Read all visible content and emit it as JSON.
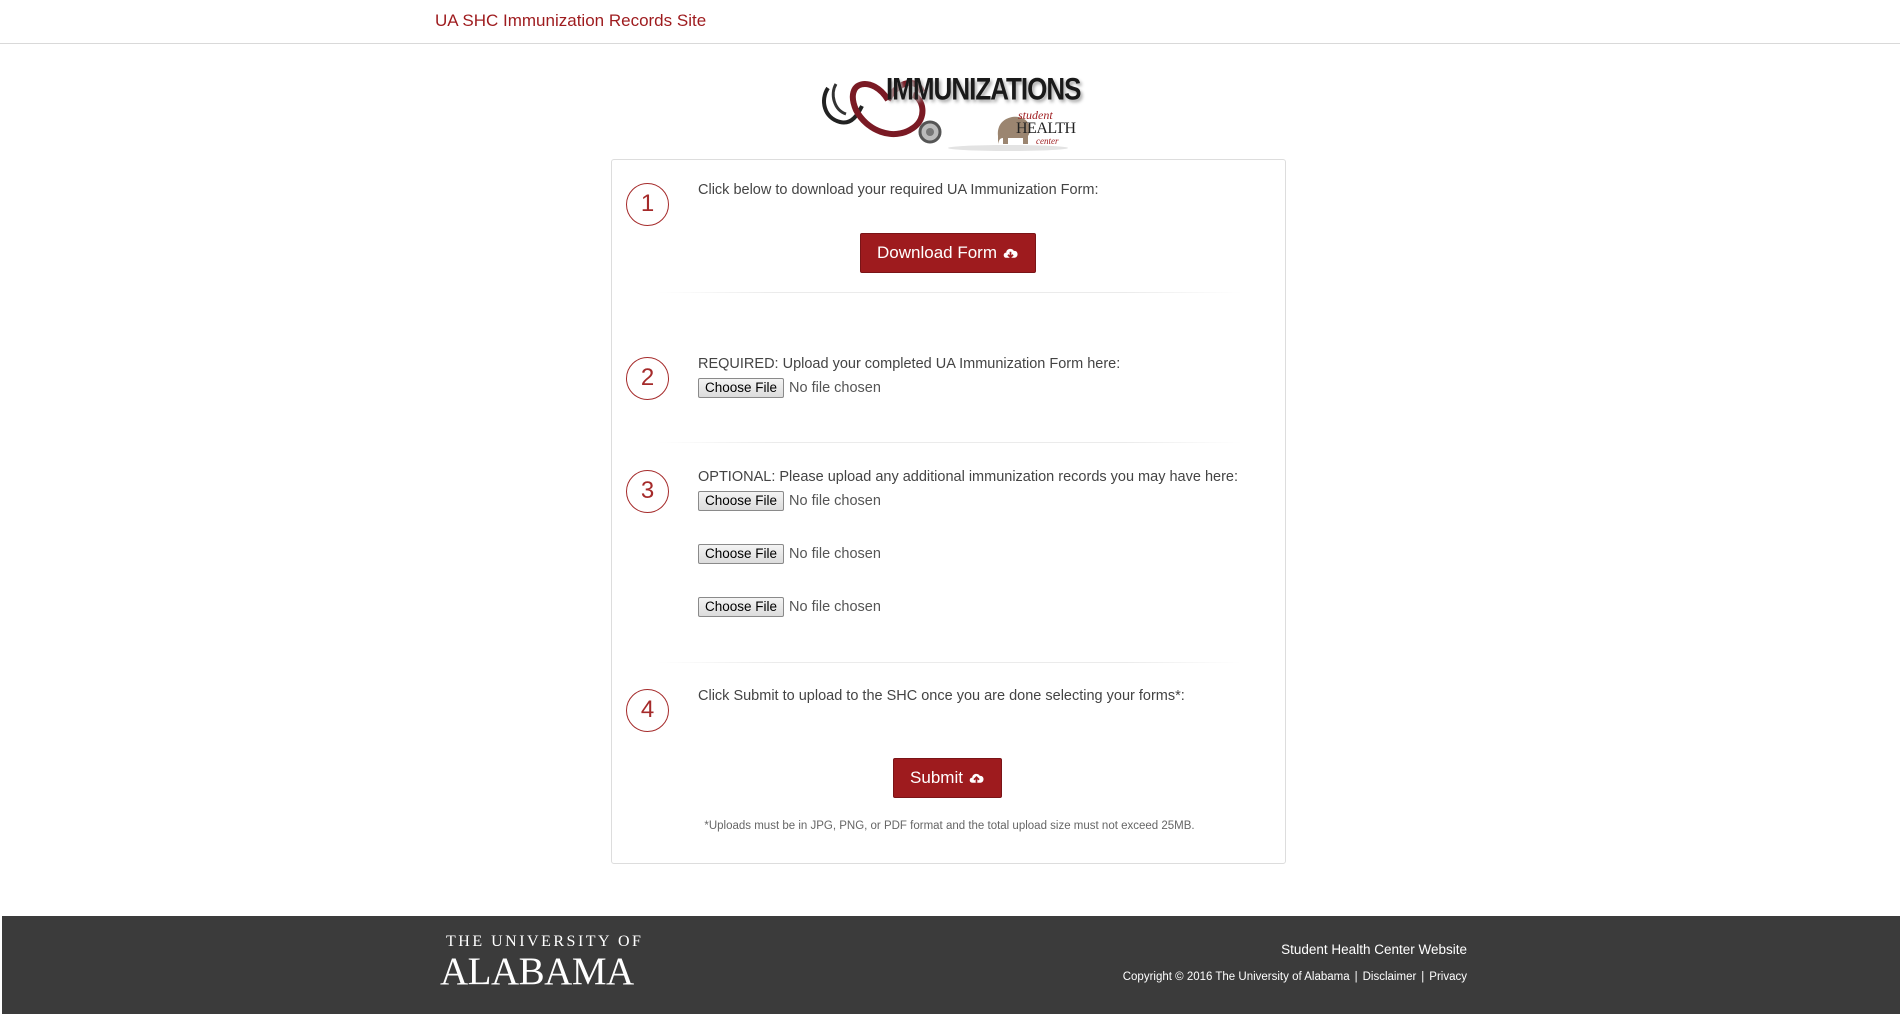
{
  "header": {
    "site_title": "UA SHC Immunization Records Site"
  },
  "logo": {
    "title": "IMMUNIZATIONS",
    "sub_script": "student",
    "sub_main": "HEALTH",
    "sub_small": "center"
  },
  "steps": [
    {
      "number": "1",
      "text": "Click below to download your required UA Immunization Form:"
    },
    {
      "number": "2",
      "text": "REQUIRED: Upload your completed UA Immunization Form here:"
    },
    {
      "number": "3",
      "text": "OPTIONAL: Please upload any additional immunization records you may have here:"
    },
    {
      "number": "4",
      "text": "Click Submit to upload to the SHC once you are done selecting your forms*:"
    }
  ],
  "download_button": {
    "label": "Download Form"
  },
  "file_inputs": [
    {
      "button": "Choose File",
      "status": "No file chosen"
    },
    {
      "button": "Choose File",
      "status": "No file chosen"
    },
    {
      "button": "Choose File",
      "status": "No file chosen"
    },
    {
      "button": "Choose File",
      "status": "No file chosen"
    }
  ],
  "submit_button": {
    "label": "Submit"
  },
  "upload_note": "*Uploads must be in JPG, PNG, or PDF format and the total upload size must not exceed 25MB.",
  "footer": {
    "ua_line1": "THE UNIVERSITY OF",
    "ua_line2": "ALABAMA",
    "shc_link": "Student Health Center Website",
    "copyright": "Copyright © 2016 The University of Alabama",
    "separator": "|",
    "disclaimer": "Disclaimer",
    "privacy": "Privacy"
  },
  "icons": {
    "download": "cloud-download-icon",
    "upload": "cloud-upload-icon"
  },
  "colors": {
    "brand": "#9e1b1e",
    "footer_bg": "#3b3b3b",
    "step_circle": "#a52a2a"
  }
}
